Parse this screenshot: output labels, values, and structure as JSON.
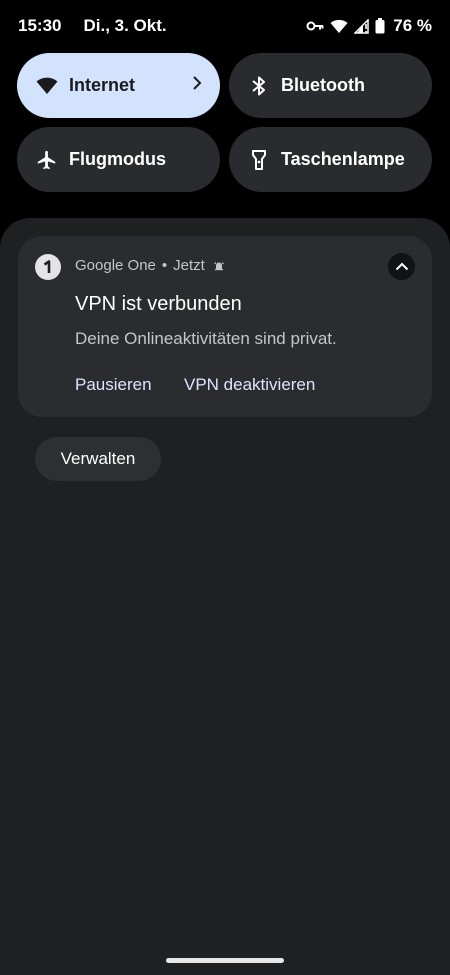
{
  "status_bar": {
    "time": "15:30",
    "date": "Di., 3. Okt.",
    "battery": "76 %",
    "icons": [
      "vpn-key-icon",
      "wifi-icon",
      "cellular-signal-icon",
      "battery-icon"
    ]
  },
  "quick_settings": {
    "tiles": [
      {
        "label": "Internet",
        "icon": "wifi-icon",
        "active": true,
        "has_chevron": true
      },
      {
        "label": "Bluetooth",
        "icon": "bluetooth-icon",
        "active": false
      },
      {
        "label": "Flugmodus",
        "icon": "airplane-icon",
        "active": false
      },
      {
        "label": "Taschenlampe",
        "icon": "flashlight-icon",
        "active": false
      }
    ]
  },
  "notification": {
    "app_name": "Google One",
    "separator": "•",
    "time": "Jetzt",
    "title": "VPN ist verbunden",
    "text": "Deine Onlineaktivitäten sind privat.",
    "actions": [
      "Pausieren",
      "VPN deaktivieren"
    ]
  },
  "manage_label": "Verwalten",
  "colors": {
    "active_tile": "#d3e3fd",
    "inactive_tile": "#2a2b2e",
    "shade_background": "#1f2022",
    "card_background": "#2b2c2f",
    "action_text": "#dfe3ff"
  }
}
